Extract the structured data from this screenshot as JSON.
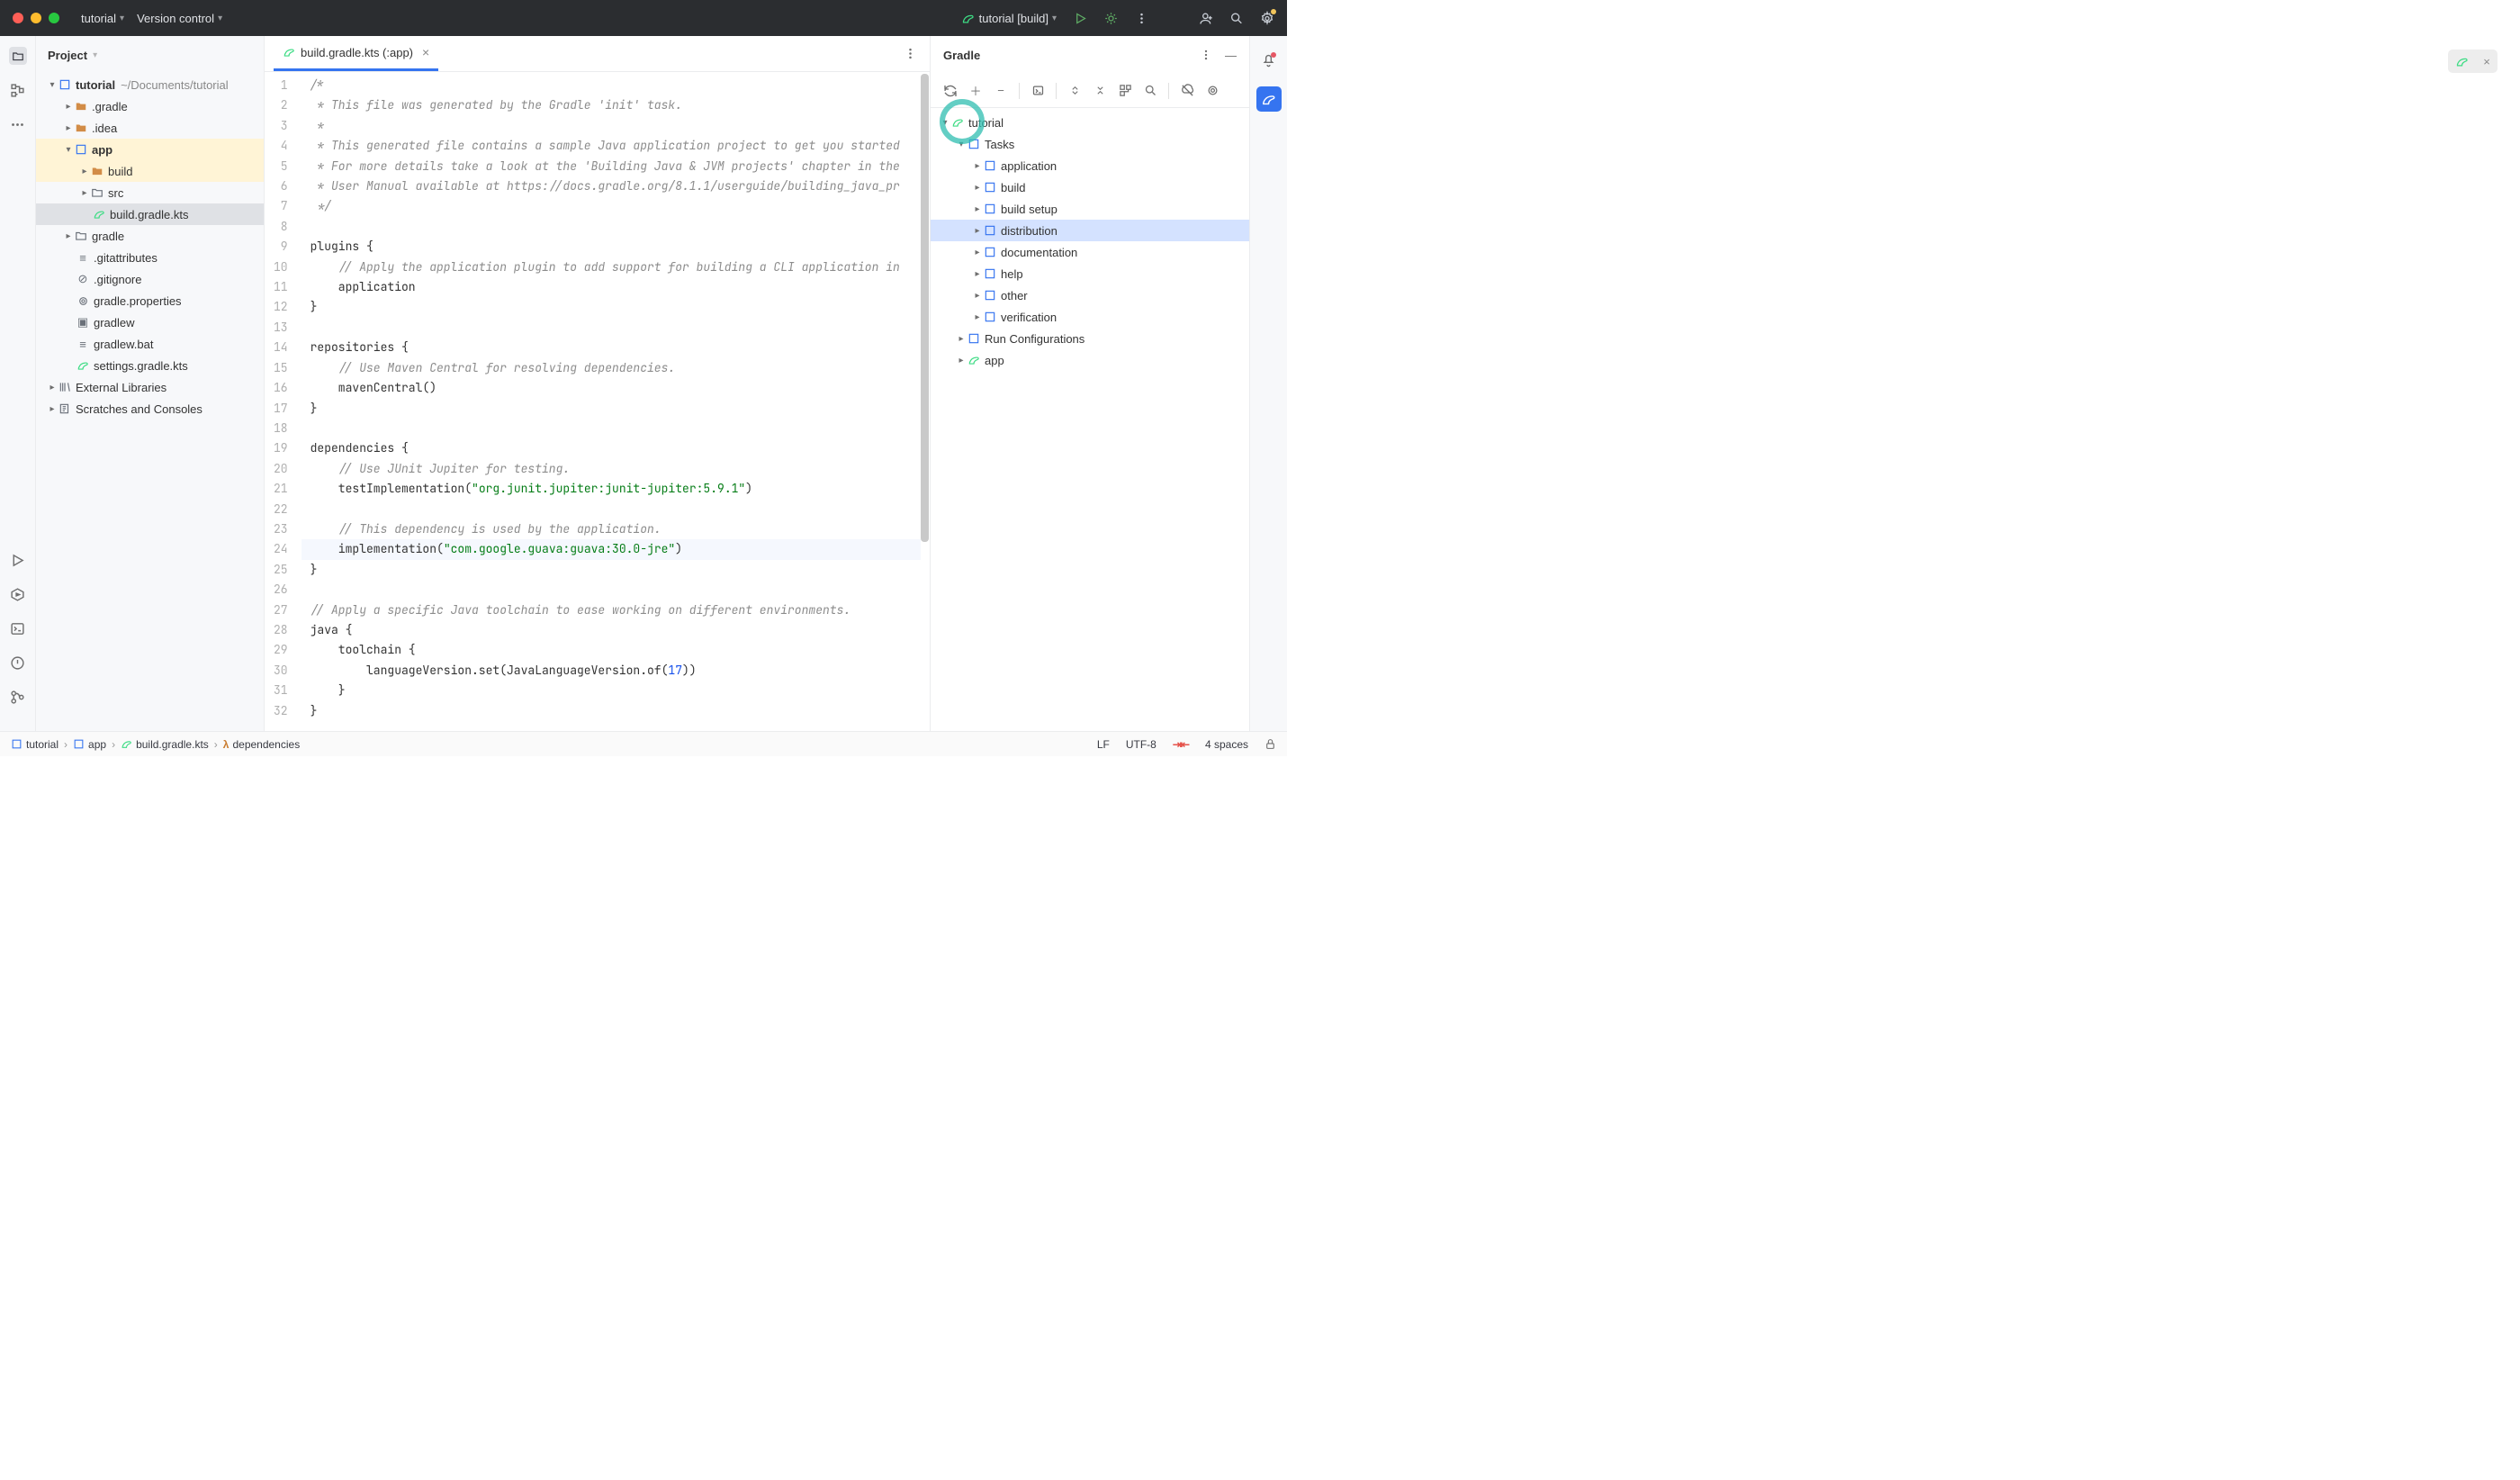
{
  "titlebar": {
    "project": "tutorial",
    "vcs": "Version control",
    "runconfig": "tutorial [build]"
  },
  "project_panel": {
    "title": "Project",
    "root": {
      "name": "tutorial",
      "path": "~/Documents/tutorial"
    },
    "nodes": {
      "gradle_dir": ".gradle",
      "idea_dir": ".idea",
      "app": "app",
      "build": "build",
      "src": "src",
      "build_gradle": "build.gradle.kts",
      "gradle": "gradle",
      "gitattributes": ".gitattributes",
      "gitignore": ".gitignore",
      "gradle_properties": "gradle.properties",
      "gradlew": "gradlew",
      "gradlew_bat": "gradlew.bat",
      "settings_gradle": "settings.gradle.kts",
      "external_libs": "External Libraries",
      "scratches": "Scratches and Consoles"
    }
  },
  "editor": {
    "tab": {
      "label": "build.gradle.kts (:app)"
    },
    "lines": [
      {
        "n": 1,
        "cm": "/*"
      },
      {
        "n": 2,
        "cm": " * This file was generated by the Gradle 'init' task."
      },
      {
        "n": 3,
        "cm": " *"
      },
      {
        "n": 4,
        "cm": " * This generated file contains a sample Java application project to get you started"
      },
      {
        "n": 5,
        "cm": " * For more details take a look at the 'Building Java & JVM projects' chapter in the"
      },
      {
        "n": 6,
        "cm": " * User Manual available at https://docs.gradle.org/8.1.1/userguide/building_java_pr"
      },
      {
        "n": 7,
        "cm": " */"
      },
      {
        "n": 8,
        "t": ""
      },
      {
        "n": 9,
        "t": "plugins {"
      },
      {
        "n": 10,
        "cmi": "    // Apply the application plugin to add support for building a CLI application in"
      },
      {
        "n": 11,
        "t": "    application"
      },
      {
        "n": 12,
        "t": "}"
      },
      {
        "n": 13,
        "t": ""
      },
      {
        "n": 14,
        "t": "repositories {"
      },
      {
        "n": 15,
        "cmi": "    // Use Maven Central for resolving dependencies."
      },
      {
        "n": 16,
        "t": "    mavenCentral()"
      },
      {
        "n": 17,
        "t": "}"
      },
      {
        "n": 18,
        "t": ""
      },
      {
        "n": 19,
        "t": "dependencies {"
      },
      {
        "n": 20,
        "cmi": "    // Use JUnit Jupiter for testing."
      },
      {
        "n": 21,
        "pre": "    testImplementation(",
        "str": "\"org.junit.jupiter:junit-jupiter:5.9.1\"",
        "post": ")"
      },
      {
        "n": 22,
        "t": ""
      },
      {
        "n": 23,
        "cmi": "    // This dependency is used by the application."
      },
      {
        "n": 24,
        "pre": "    implementation(",
        "str": "\"com.google.guava:guava:30.0-jre\"",
        "post": ")",
        "cur": true
      },
      {
        "n": 25,
        "t": "}"
      },
      {
        "n": 26,
        "t": ""
      },
      {
        "n": 27,
        "cmi": "// Apply a specific Java toolchain to ease working on different environments."
      },
      {
        "n": 28,
        "t": "java {"
      },
      {
        "n": 29,
        "t": "    toolchain {"
      },
      {
        "n": 30,
        "pre": "        languageVersion.set(JavaLanguageVersion.of(",
        "num": "17",
        "post": "))"
      },
      {
        "n": 31,
        "t": "    }"
      },
      {
        "n": 32,
        "t": "}"
      }
    ]
  },
  "gradle_panel": {
    "title": "Gradle",
    "root": "tutorial",
    "tasks_label": "Tasks",
    "tasks": [
      "application",
      "build",
      "build setup",
      "distribution",
      "documentation",
      "help",
      "other",
      "verification"
    ],
    "selected_task_index": 3,
    "run_configs": "Run Configurations",
    "app_node": "app"
  },
  "breadcrumbs": [
    "tutorial",
    "app",
    "build.gradle.kts",
    "dependencies"
  ],
  "statusbar": {
    "lf": "LF",
    "enc": "UTF-8",
    "indent": "4 spaces"
  }
}
